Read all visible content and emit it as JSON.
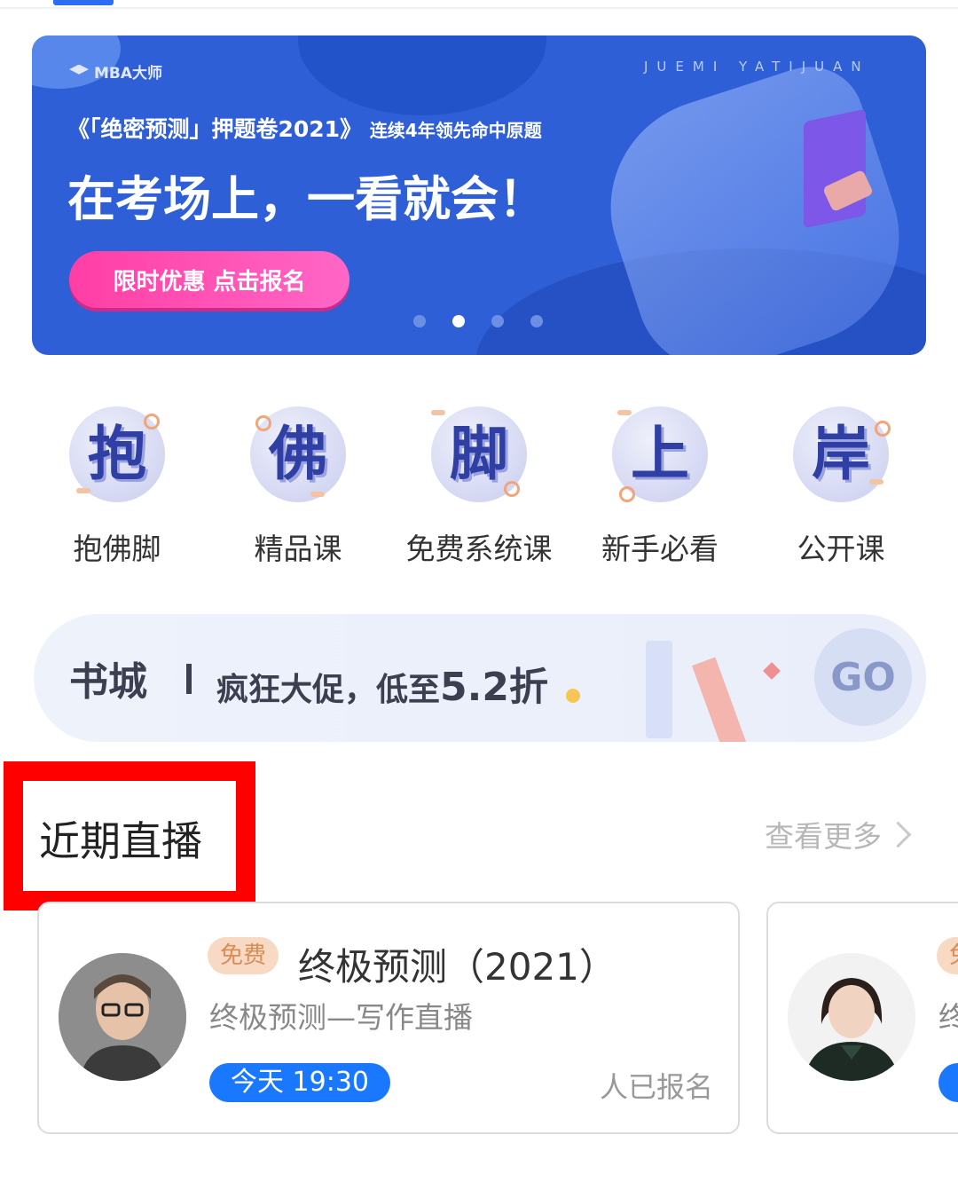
{
  "banner": {
    "brand": "MBA大师",
    "watermark": "JUEMI YATIJUAN",
    "subtitle": "《「绝密预测」押题卷2021》",
    "subtitle_small": "连续4年领先命中原题",
    "title": "在考场上，一看就会！",
    "button": "限时优惠 点击报名",
    "dots": 4,
    "active_dot": 2
  },
  "categories": [
    {
      "char": "抱",
      "label": "抱佛脚"
    },
    {
      "char": "佛",
      "label": "精品课"
    },
    {
      "char": "脚",
      "label": "免费系统课"
    },
    {
      "char": "上",
      "label": "新手必看"
    },
    {
      "char": "岸",
      "label": "公开课"
    }
  ],
  "bookstore": {
    "title": "书城",
    "promo_prefix": "疯狂大促，低至",
    "promo_value": "5.2折",
    "go_label": "GO"
  },
  "section": {
    "title": "近期直播",
    "more_label": "查看更多"
  },
  "live_cards": [
    {
      "tag": "免费",
      "title": "终极预测（2021）",
      "subtitle": "终极预测—写作直播",
      "time": "今天 19:30",
      "count_text": "人已报名"
    },
    {
      "tag": "免",
      "title": "",
      "subtitle": "终",
      "time": "",
      "count_text": ""
    }
  ],
  "colors": {
    "accent": "#1a78ff",
    "banner_bg": "#2f5fd6",
    "highlight": "#ff0000"
  }
}
